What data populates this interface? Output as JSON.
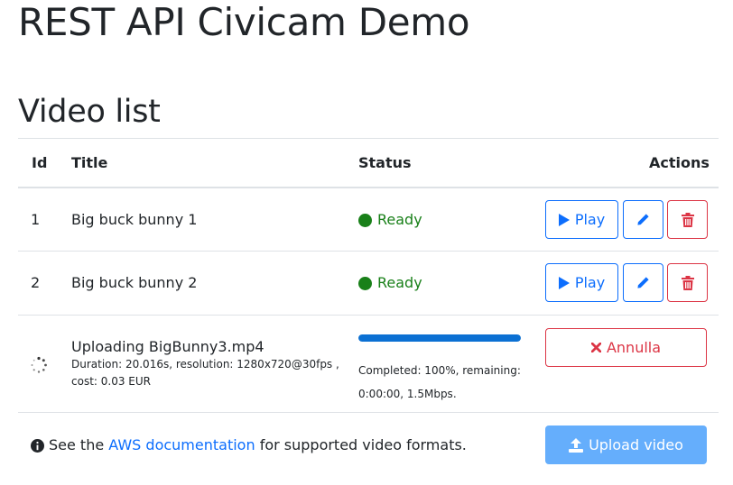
{
  "page": {
    "title": "REST API Civicam Demo",
    "section_title": "Video list"
  },
  "table": {
    "headers": {
      "id": "Id",
      "title": "Title",
      "status": "Status",
      "actions": "Actions"
    },
    "rows": [
      {
        "id": "1",
        "title": "Big buck bunny 1",
        "status": "Ready",
        "play_label": "Play"
      },
      {
        "id": "2",
        "title": "Big buck bunny 2",
        "status": "Ready",
        "play_label": "Play"
      }
    ],
    "uploading": {
      "title": "Uploading BigBunny3.mp4",
      "meta_line1": "Duration: 20.016s, resolution: 1280x720@30fps ,",
      "meta_line2": "cost: 0.03 EUR",
      "progress": 100,
      "progress_line1": "Completed: 100%, remaining:",
      "progress_line2": "0:00:00, 1.5Mbps.",
      "cancel_label": "Annulla"
    }
  },
  "footer": {
    "text_before": "See the",
    "link_text": "AWS documentation",
    "text_after": "for supported video formats.",
    "upload_label": "Upload video"
  },
  "colors": {
    "primary": "#0d6efd",
    "danger": "#dc3545",
    "success": "#198019",
    "upload_bg": "#65aefc"
  },
  "icons": [
    "play-icon",
    "pencil-icon",
    "trash-icon",
    "spinner-icon",
    "times-icon",
    "info-circle-icon",
    "upload-icon"
  ]
}
